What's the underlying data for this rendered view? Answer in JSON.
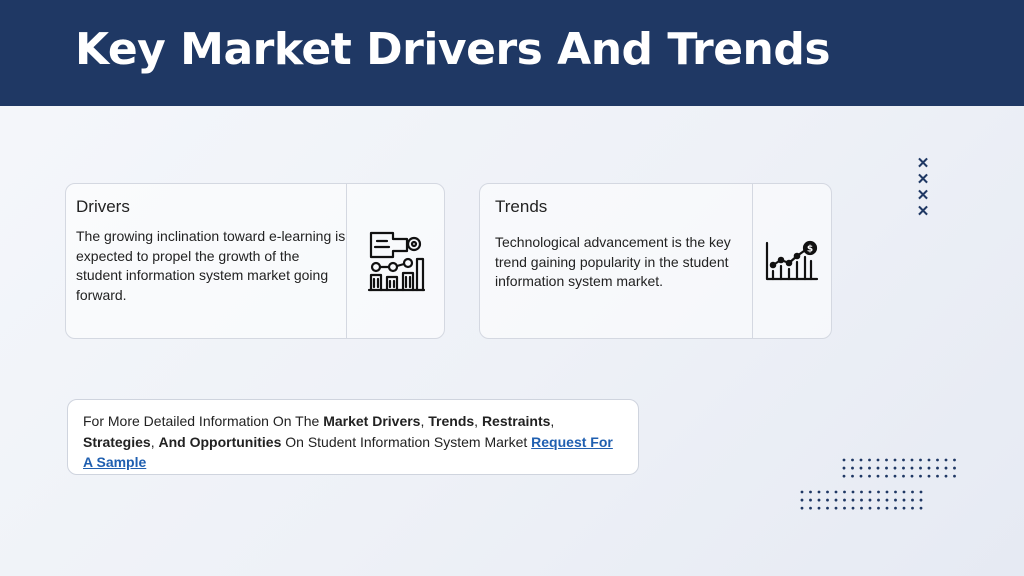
{
  "header": {
    "title": "Key Market Drivers And Trends"
  },
  "drivers": {
    "title": "Drivers",
    "text": "The growing inclination toward e-learning is expected to propel the growth of the student information system market going forward.",
    "icon": "elearning-chart-icon"
  },
  "trends": {
    "title": "Trends",
    "text": "Technological advancement is the key trend gaining popularity in the student information system market.",
    "icon": "growth-chart-dollar-icon"
  },
  "info": {
    "t1": "For More Detailed Information On The ",
    "b1": "Market Drivers",
    "t2": ", ",
    "b2": "Trends",
    "t3": ", ",
    "b3": "Restraints",
    "t4": ", ",
    "b4": "Strategies",
    "t5": ", ",
    "b5": "And Opportunities",
    "t6": " On Student Information System Market ",
    "link": "Request For A Sample"
  },
  "colors": {
    "header": "#1f3864",
    "accent": "#1f3864",
    "link": "#1f5fb0"
  }
}
